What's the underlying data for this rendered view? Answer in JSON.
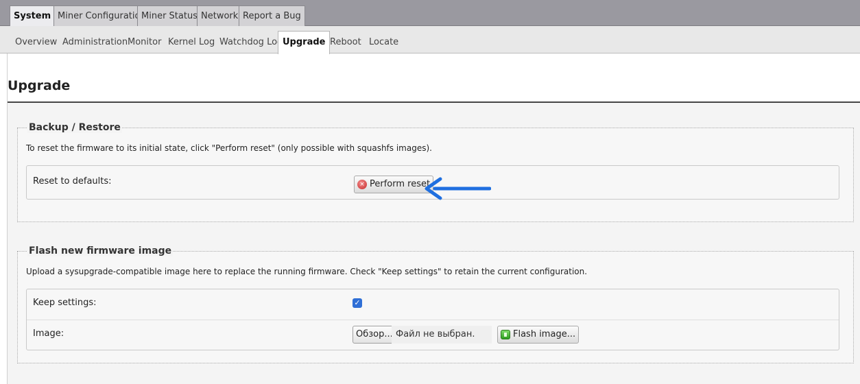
{
  "top_tabs": [
    {
      "label": "System",
      "active": true
    },
    {
      "label": "Miner Configuration",
      "active": false
    },
    {
      "label": "Miner Status",
      "active": false
    },
    {
      "label": "Network",
      "active": false
    },
    {
      "label": "Report a Bug",
      "active": false
    }
  ],
  "sub_tabs": [
    {
      "label": "Overview"
    },
    {
      "label": "Administration"
    },
    {
      "label": "Monitor"
    },
    {
      "label": "Kernel Log"
    },
    {
      "label": "Watchdog Log"
    },
    {
      "label": "Upgrade",
      "active": true
    },
    {
      "label": "Reboot"
    },
    {
      "label": "Locate"
    }
  ],
  "page": {
    "title": "Upgrade"
  },
  "backup": {
    "legend": "Backup / Restore",
    "description": "To reset the firmware to its initial state, click \"Perform reset\" (only possible with squashfs images).",
    "reset_label": "Reset to defaults:",
    "reset_button": "Perform reset"
  },
  "flash": {
    "legend": "Flash new firmware image",
    "description": "Upload a sysupgrade-compatible image here to replace the running firmware. Check \"Keep settings\" to retain the current configuration.",
    "keep_label": "Keep settings:",
    "keep_checked": true,
    "image_label": "Image:",
    "browse_button": "Обзор...",
    "file_status": "Файл не выбран.",
    "flash_button": "Flash image..."
  },
  "colors": {
    "accent": "#2f6fd6",
    "arrow": "#1f6fe0"
  },
  "icons": {
    "reset": "reset-icon",
    "flash": "flash-icon",
    "arrow": "arrow-left-icon"
  }
}
